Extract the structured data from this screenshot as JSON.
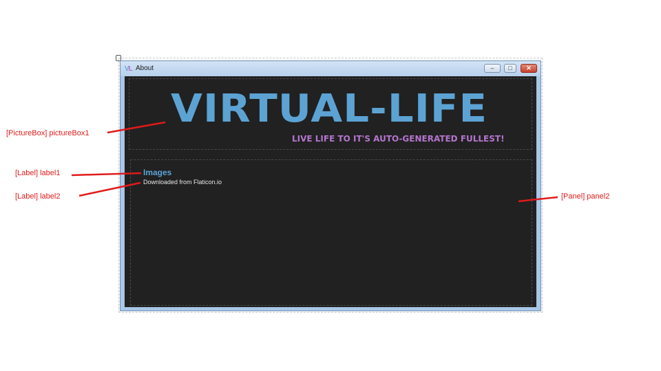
{
  "window": {
    "title": "About",
    "icon_text": "VL",
    "controls": {
      "minimize_icon": "minimize-icon",
      "maximize_icon": "maximize-icon",
      "close_icon": "close-icon"
    }
  },
  "picture_box": {
    "logo_title": "VIRTUAL-LIFE",
    "logo_tagline": "LIVE LIFE TO IT'S AUTO-GENERATED FULLEST!"
  },
  "panel2": {
    "label1": "Images",
    "label2": "Downloaded from Flaticon.io"
  },
  "annotations": [
    {
      "id": "picturebox",
      "text": "[PictureBox] pictureBox1"
    },
    {
      "id": "label1",
      "text": "[Label] label1"
    },
    {
      "id": "label2",
      "text": "[Label] label2"
    },
    {
      "id": "panel2",
      "text": "[Panel] panel2"
    }
  ],
  "colors": {
    "client_background": "#212121",
    "logo_blue": "#5ca3d4",
    "logo_purple": "#b575cf",
    "annotation_red": "#e11a1a",
    "title_bar": "#b7d0ec"
  }
}
